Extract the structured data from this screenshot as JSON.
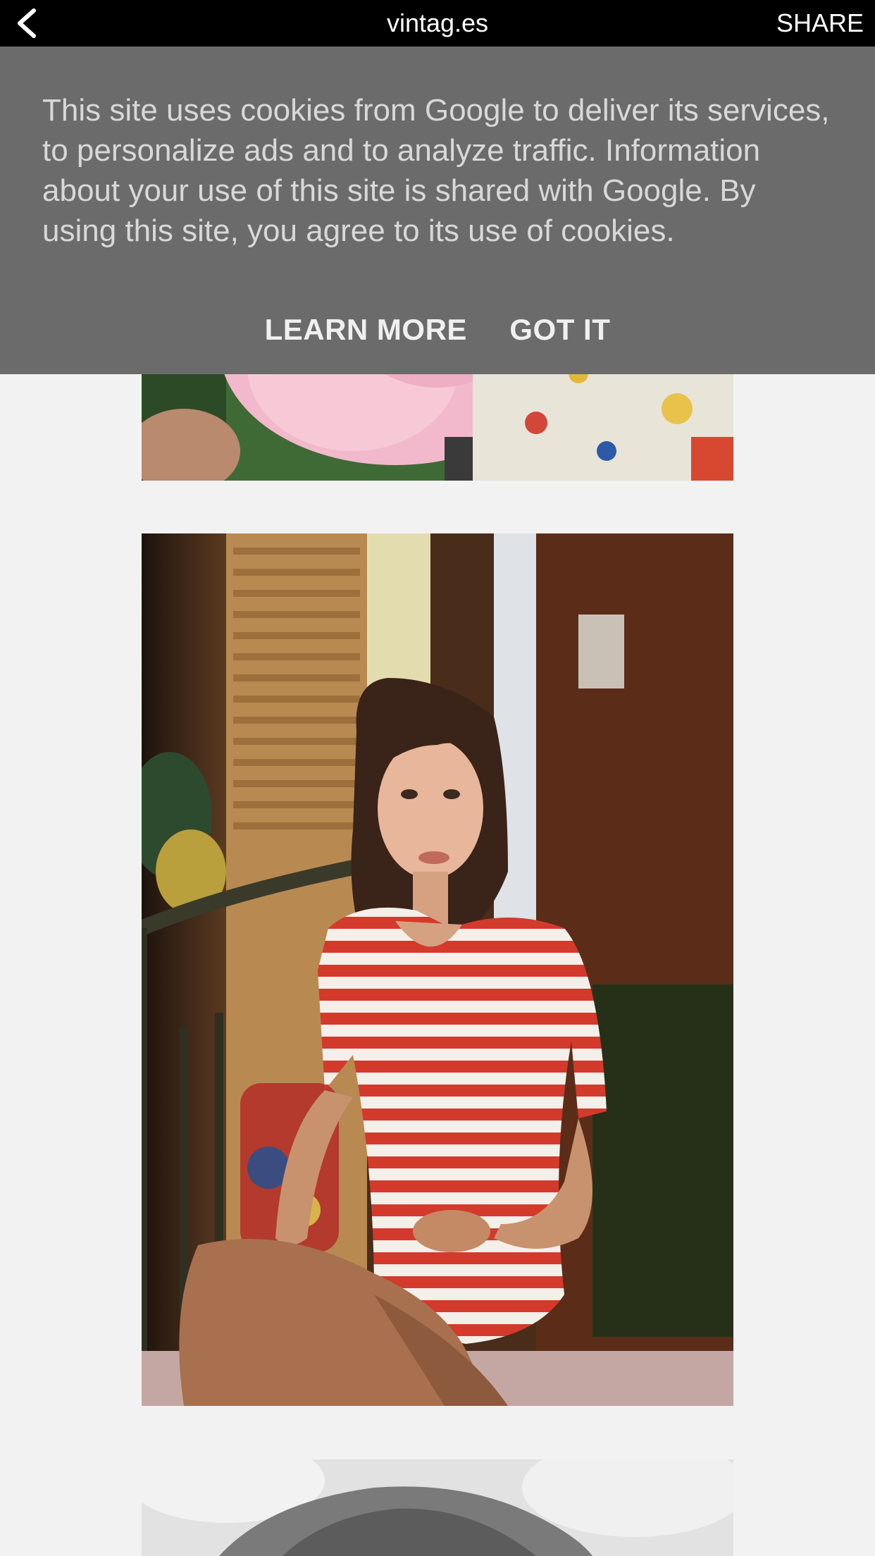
{
  "header": {
    "title": "vintag.es",
    "share_label": "SHARE",
    "back_icon": "chevron-left-icon",
    "background": "#000000"
  },
  "cookie_banner": {
    "message": "This site uses cookies from Google to deliver its services, to personalize ads and to analyze traffic. Information about your use of this site is shared with Google. By using this site, you agree to its use of cookies.",
    "learn_more_label": "LEARN MORE",
    "got_it_label": "GOT IT",
    "background": "#6b6b6b"
  },
  "feed": {
    "background": "#f2f2f2",
    "photos": [
      {
        "description_icon": "photo-cotton-candy"
      },
      {
        "description_icon": "photo-woman-striped-dress"
      },
      {
        "description_icon": "photo-black-and-white"
      }
    ]
  }
}
